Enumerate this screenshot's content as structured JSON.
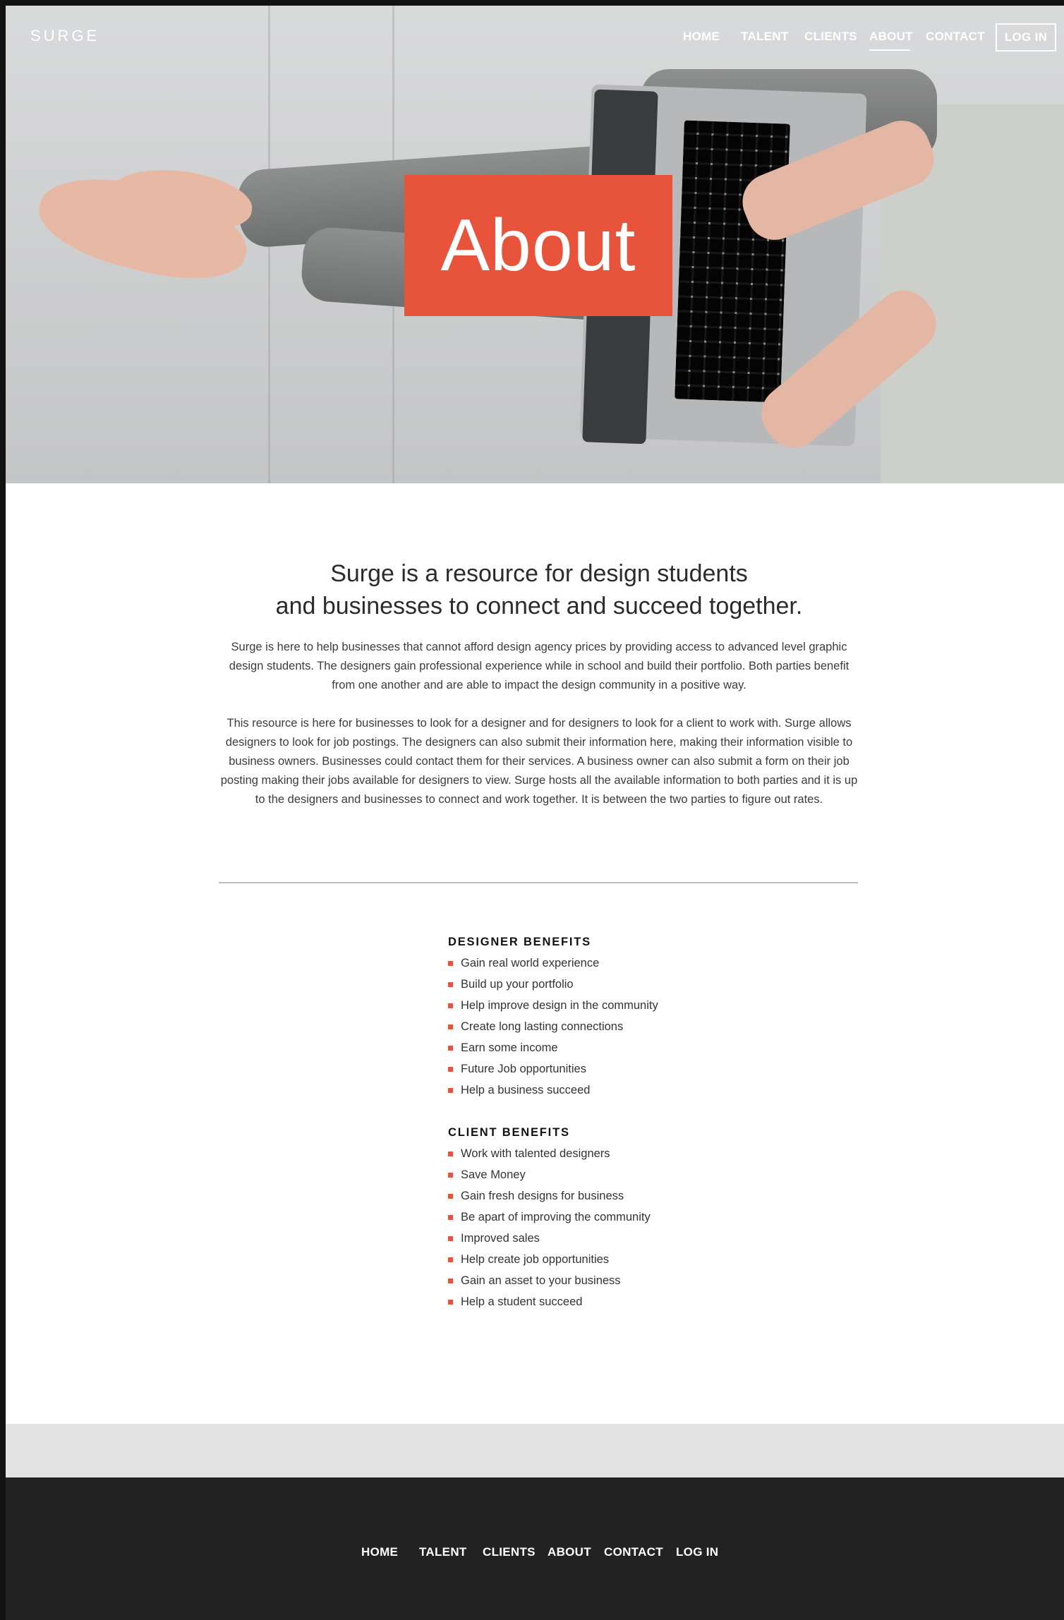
{
  "brand": {
    "logo": "SURGE",
    "accent": "#e8533c"
  },
  "header": {
    "nav": [
      {
        "label": "HOME"
      },
      {
        "label": "TALENT"
      },
      {
        "label": "CLIENTS"
      },
      {
        "label": "ABOUT",
        "active": true
      },
      {
        "label": "CONTACT"
      }
    ],
    "login_label": "LOG IN"
  },
  "hero": {
    "title": "About"
  },
  "intro": {
    "headline_line1": "Surge is a resource for design students",
    "headline_line2": "and businesses to connect and succeed together.",
    "paragraph1": "Surge is here to help businesses that cannot afford design agency prices by providing access to advanced level graphic design students. The designers gain professional experience while in school and build their portfolio. Both parties benefit from one another and are able to impact the design community in a positive way.",
    "paragraph2": "This resource is here for businesses to look for a designer and for designers to look for a client to work with. Surge allows designers to look for job postings. The designers can also submit their information here, making their information visible to business owners. Businesses could contact them for their services. A business owner can also submit a form on their job posting making their jobs available for designers to view. Surge hosts all the available information to both parties and it is up to the designers and businesses to connect and work together. It is between the two parties to figure out rates."
  },
  "designer_benefits": {
    "heading": "DESIGNER BENEFITS",
    "items": [
      "Gain real world experience",
      "Build up your portfolio",
      "Help improve design in the community",
      "Create long lasting connections",
      "Earn some income",
      "Future Job opportunities",
      "Help a business succeed"
    ]
  },
  "client_benefits": {
    "heading": "CLIENT BENEFITS",
    "items": [
      "Work with talented designers",
      "Save Money",
      "Gain fresh designs for business",
      "Be apart of improving the community",
      "Improved sales",
      "Help create job opportunities",
      "Gain an asset to your business",
      "Help a student succeed"
    ]
  },
  "footer": {
    "nav": [
      {
        "label": "HOME"
      },
      {
        "label": "TALENT"
      },
      {
        "label": "CLIENTS"
      },
      {
        "label": "ABOUT"
      },
      {
        "label": "CONTACT"
      },
      {
        "label": "LOG IN"
      }
    ]
  }
}
